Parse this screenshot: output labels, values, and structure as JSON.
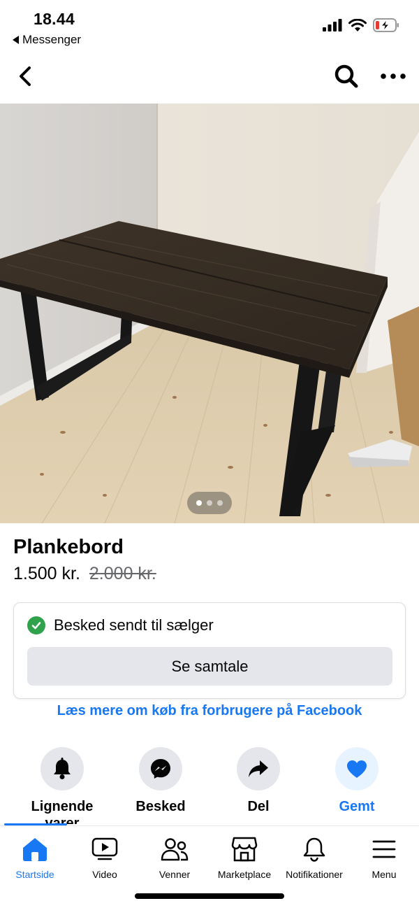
{
  "status_bar": {
    "time": "18.44",
    "back_app": "Messenger",
    "icons": [
      "signal-icon",
      "wifi-icon",
      "battery-charging-icon"
    ]
  },
  "top_nav": {
    "icons": [
      "back-chevron-icon",
      "search-icon",
      "more-horizontal-icon"
    ]
  },
  "listing": {
    "photo_count": 3,
    "photo_index": 1,
    "title": "Plankebord",
    "price": "1.500 kr.",
    "original_price": "2.000 kr."
  },
  "message_card": {
    "status_text": "Besked sendt til sælger",
    "button_label": "Se samtale"
  },
  "learn_more_link": "Læs mere om køb fra forbrugere på Facebook",
  "actions": [
    {
      "label": "Lignende varer",
      "icon": "bell-icon"
    },
    {
      "label": "Besked",
      "icon": "messenger-icon"
    },
    {
      "label": "Del",
      "icon": "share-arrow-icon"
    },
    {
      "label": "Gemt",
      "icon": "heart-icon"
    }
  ],
  "tabs": [
    {
      "label": "Startside",
      "icon": "home-icon",
      "active": true
    },
    {
      "label": "Video",
      "icon": "video-icon"
    },
    {
      "label": "Venner",
      "icon": "friends-icon"
    },
    {
      "label": "Marketplace",
      "icon": "marketplace-icon"
    },
    {
      "label": "Notifikationer",
      "icon": "bell-icon"
    },
    {
      "label": "Menu",
      "icon": "menu-icon"
    }
  ],
  "colors": {
    "accent": "#1877f2",
    "success": "#31a24c",
    "button_bg": "#e4e6eb",
    "secondary_text": "#65676b"
  }
}
